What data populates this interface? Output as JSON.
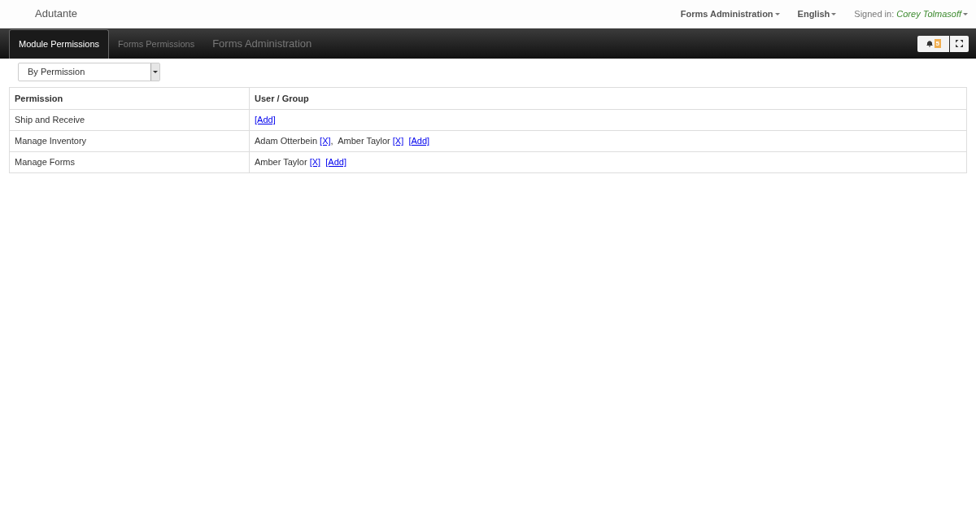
{
  "brand": "Adutante",
  "top_menu": [
    {
      "label": "Forms Administration",
      "kind": "dropdown"
    },
    {
      "label": "English",
      "kind": "dropdown"
    },
    {
      "label": "Signed in:",
      "value": "Corey Tolmasoff",
      "kind": "user"
    }
  ],
  "tabs": [
    {
      "label": "Module Permissions",
      "kind": "tab",
      "selected": true
    },
    {
      "label": "Forms Permissions",
      "kind": "tab",
      "selected": false
    },
    {
      "label": "Forms Administration",
      "kind": "heading",
      "selected": false
    }
  ],
  "notification_badge": "5",
  "view_select": {
    "value": "By Permission"
  },
  "table": {
    "columns": [
      "Permission",
      "User / Group"
    ],
    "rows": [
      {
        "permission": "Ship and Receive",
        "user_group": {
          "add": "[Add]"
        }
      },
      {
        "permission": "Manage Inventory",
        "user_group": {
          "users": [
            {
              "name": "Adam Otterbein",
              "remove": "[X]",
              "separator": ","
            },
            {
              "name": "Amber Taylor",
              "remove": "[X]"
            }
          ],
          "add": "[Add]"
        }
      },
      {
        "permission": "Manage Forms",
        "user_group": {
          "users": [
            {
              "name": "Amber Taylor",
              "remove": "[X]"
            }
          ],
          "add": "[Add]"
        }
      }
    ]
  }
}
